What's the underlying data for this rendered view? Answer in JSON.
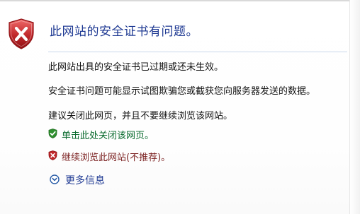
{
  "title": "此网站的安全证书有问题。",
  "paragraphs": [
    "此网站出具的安全证书已过期或还未生效。",
    "安全证书问题可能显示试图欺骗您或截获您向服务器发送的数据。",
    "建议关闭此网页，并且不要继续浏览该网站。"
  ],
  "actions": {
    "close_page": "单击此处关闭该网页。",
    "continue_site": "继续浏览此网站(不推荐)。"
  },
  "more_info": "更多信息",
  "colors": {
    "title": "#1f3a93",
    "link_safe": "#0a6b2e",
    "link_danger": "#7a1f1f",
    "shield_red": "#c0282b",
    "shield_green": "#2f8f2f"
  },
  "icons": {
    "header": "error-shield-icon",
    "close_page": "green-check-shield-icon",
    "continue_site": "red-x-shield-icon",
    "more_info": "chevron-down-circle-icon"
  }
}
